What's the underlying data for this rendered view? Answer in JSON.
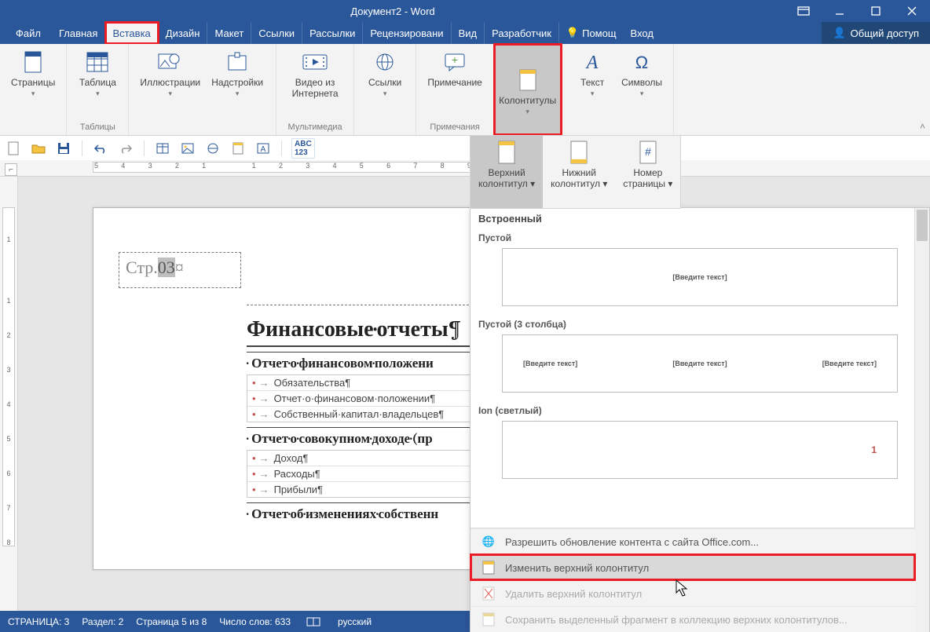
{
  "title": "Документ2 - Word",
  "tabs": {
    "file": "Файл",
    "home": "Главная",
    "insert": "Вставка",
    "design": "Дизайн",
    "layout": "Макет",
    "references": "Ссылки",
    "mailings": "Рассылки",
    "review": "Рецензировани",
    "view": "Вид",
    "developer": "Разработчик",
    "help": "Помощ",
    "signin": "Вход",
    "share": "Общий доступ"
  },
  "ribbon": {
    "pages": "Страницы",
    "table": "Таблица",
    "tables_group": "Таблицы",
    "illus": "Иллюстрации",
    "addins": "Надстройки",
    "video1": "Видео из",
    "video2": "Интернета",
    "media_group": "Мультимедиа",
    "links": "Ссылки",
    "comment": "Примечание",
    "comments_group": "Примечания",
    "headerfooter": "Колонтитулы",
    "text": "Текст",
    "symbols": "Символы"
  },
  "subribbon": {
    "header1": "Верхний",
    "header2": "колонтитул",
    "footer1": "Нижний",
    "footer2": "колонтитул",
    "pagenum1": "Номер",
    "pagenum2": "страницы"
  },
  "ruler_h": [
    "5",
    "4",
    "3",
    "2",
    "1",
    "",
    "1",
    "2",
    "3",
    "4",
    "5",
    "6",
    "7",
    "8",
    "9"
  ],
  "ruler_v": [
    "",
    "1",
    "",
    "1",
    "2",
    "3",
    "4",
    "5",
    "6",
    "7",
    "8"
  ],
  "doc": {
    "header_prefix": "Стр.",
    "header_sel": "03",
    "header_mark": "¤",
    "h1": "Финансовые·отчеты¶",
    "h2a": "Отчет·о·финансовом·положени",
    "toc_a": [
      "Обязательства¶",
      "Отчет·о·финансовом·положении¶",
      "Собственный·капитал·владельцев¶"
    ],
    "h2b": "Отчет·о·совокупном·доходе·(пр",
    "toc_b": [
      "Доход¶",
      "Расходы¶",
      "Прибыли¶"
    ],
    "h2c": "Отчет·об·изменениях·собственн"
  },
  "gallery": {
    "builtin": "Встроенный",
    "opt_empty": "Пустой",
    "opt_empty3": "Пустой (3 столбца)",
    "opt_ion": "Ion (светлый)",
    "placeholder": "[Введите текст]",
    "ion_num": "1",
    "office": "Разрешить обновление контента с сайта Office.com...",
    "edit": "Изменить верхний колонтитул",
    "delete": "Удалить верхний колонтитул",
    "save": "Сохранить выделенный фрагмент в коллекцию верхних колонтитулов..."
  },
  "status": {
    "page": "СТРАНИЦА: 3",
    "section": "Раздел: 2",
    "page_of": "Страница 5 из 8",
    "words": "Число слов: 633",
    "lang": "русский"
  }
}
